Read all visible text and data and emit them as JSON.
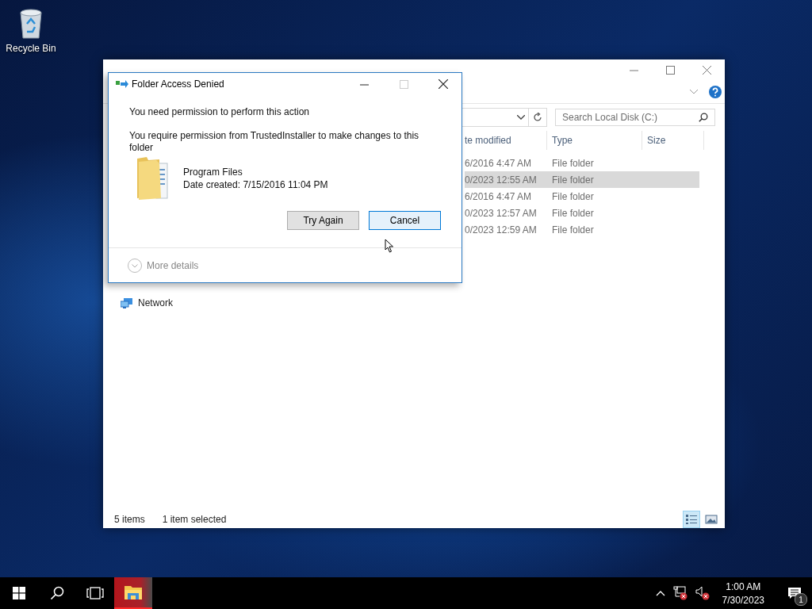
{
  "desktop_icons": [
    {
      "label": "Recycle Bin"
    }
  ],
  "explorer": {
    "search": {
      "placeholder": "Search Local Disk (C:)"
    },
    "columns": [
      "te modified",
      "Type",
      "Size"
    ],
    "rows": [
      {
        "date_modified": "6/2016 4:47 AM",
        "type": "File folder",
        "selected": false
      },
      {
        "date_modified": "0/2023 12:55 AM",
        "type": "File folder",
        "selected": true
      },
      {
        "date_modified": "6/2016 4:47 AM",
        "type": "File folder",
        "selected": false
      },
      {
        "date_modified": "0/2023 12:57 AM",
        "type": "File folder",
        "selected": false
      },
      {
        "date_modified": "0/2023 12:59 AM",
        "type": "File folder",
        "selected": false
      }
    ],
    "nav_items": [
      {
        "label": "Network"
      }
    ],
    "status_bar": {
      "item_count": "5 items",
      "selection": "1 item selected"
    },
    "view_buttons": [
      {
        "kind": "details",
        "selected": true
      },
      {
        "kind": "large-icons",
        "selected": false
      }
    ]
  },
  "dialog": {
    "title": "Folder Access Denied",
    "heading": "You need permission to perform this action",
    "message": "You require permission from TrustedInstaller to make changes to this folder",
    "file": {
      "name": "Program Files",
      "date_created": "Date created: 7/15/2016 11:04 PM"
    },
    "buttons": [
      {
        "label": "Try Again",
        "focused": false
      },
      {
        "label": "Cancel",
        "focused": true
      }
    ],
    "more_details": "More details"
  },
  "taskbar": {
    "apps": [
      {
        "kind": "explorer",
        "attention": true
      }
    ],
    "tray": [
      {
        "kind": "network"
      },
      {
        "kind": "volume"
      }
    ],
    "clock": {
      "time": "1:00 AM",
      "date": "7/30/2023"
    },
    "notifications": {
      "count": "1"
    }
  }
}
